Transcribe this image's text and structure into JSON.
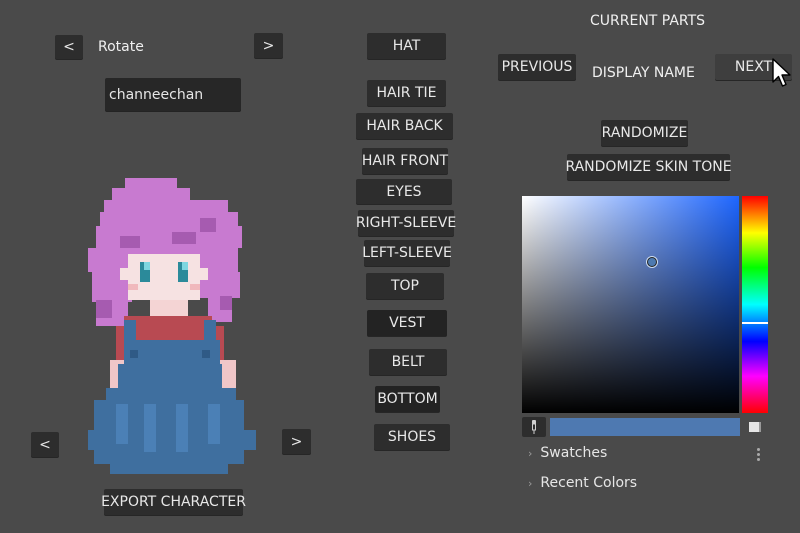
{
  "rotate": {
    "prev": "<",
    "label": "Rotate",
    "next": ">"
  },
  "name_field": {
    "value": "channeechan"
  },
  "preview_nav": {
    "prev": "<",
    "next": ">"
  },
  "export_label": "EXPORT CHARACTER",
  "parts": [
    "HAT",
    "HAIR TIE",
    "HAIR BACK",
    "HAIR FRONT",
    "EYES",
    "RIGHT-SLEEVE",
    "LEFT-SLEEVE",
    "TOP",
    "VEST",
    "BELT",
    "BOTTOM",
    "SHOES"
  ],
  "current_parts": {
    "title": "CURRENT PARTS",
    "previous": "PREVIOUS",
    "display_name": "DISPLAY NAME",
    "next": "NEXT",
    "randomize": "RANDOMIZE",
    "randomize_skin": "RANDOMIZE SKIN TONE"
  },
  "color_picker": {
    "current_color": "#4e79b1",
    "swatches_label": "Swatches",
    "recent_label": "Recent Colors"
  },
  "palette": {
    "background": "#4a4a4a",
    "button": "#2d2d2d",
    "hair": "#c87ad0",
    "skin": "#f4dcdc",
    "dress": "#3f6f9f",
    "shirt": "#b84a52"
  },
  "icons": [
    "eyedropper-icon",
    "swatch-mode-icon",
    "chevron-right-icon",
    "kebab-menu-icon",
    "mouse-pointer-icon"
  ]
}
